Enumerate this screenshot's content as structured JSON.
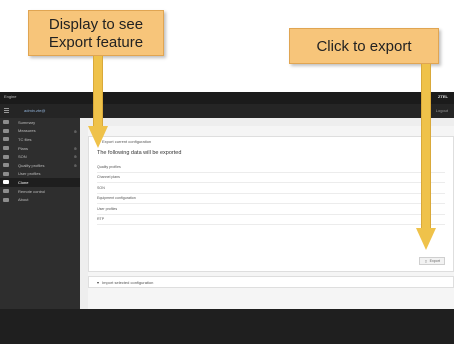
{
  "callouts": {
    "left_line1": "Display to see",
    "left_line2": "Export feature",
    "right": "Click to export"
  },
  "app": {
    "topbar_left": "Engine",
    "topbar_right": "ZTEL",
    "username": "admin.zte@",
    "userbar_right": "Logout",
    "sidebar": [
      {
        "label": "Summary",
        "icon": "dashboard-icon",
        "caret": false,
        "active": false
      },
      {
        "label": "Measures",
        "icon": "chart-icon",
        "caret": true,
        "active": false
      },
      {
        "label": "TC files",
        "icon": "file-icon",
        "caret": false,
        "active": false
      },
      {
        "label": "Plans",
        "icon": "plans-icon",
        "caret": true,
        "active": false
      },
      {
        "label": "SON",
        "icon": "son-icon",
        "caret": true,
        "active": false
      },
      {
        "label": "Quality profiles",
        "icon": "quality-icon",
        "caret": true,
        "active": false
      },
      {
        "label": "User profiles",
        "icon": "user-icon",
        "caret": false,
        "active": false
      },
      {
        "label": "Clone",
        "icon": "clone-icon",
        "caret": false,
        "active": true
      },
      {
        "label": "Remote control",
        "icon": "remote-icon",
        "caret": false,
        "active": false
      },
      {
        "label": "About",
        "icon": "info-icon",
        "caret": false,
        "active": false
      }
    ],
    "copyright": "© All rights reserved, Gainfed, S.A.",
    "export_panel": {
      "header": "Export current configuration",
      "title": "The following data will be exported",
      "rows": [
        "Quality profiles",
        "Channel plans",
        "SON",
        "Equipment configuration",
        "User profiles",
        "RTP"
      ],
      "export_button": "Export"
    },
    "import_panel": {
      "header": "Import selected configuration"
    }
  }
}
